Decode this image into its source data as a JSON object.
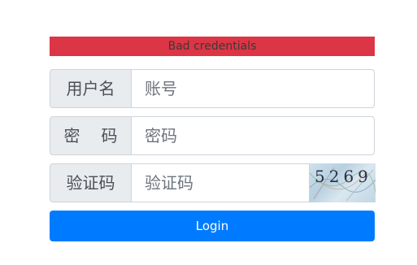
{
  "alert": {
    "message": "Bad credentials",
    "color": "#dc3545"
  },
  "form": {
    "username": {
      "label": "用户名",
      "placeholder": "账号",
      "value": ""
    },
    "password": {
      "label_chars": [
        "密",
        "码"
      ],
      "placeholder": "密码",
      "value": ""
    },
    "captcha": {
      "label": "验证码",
      "placeholder": "验证码",
      "value": "",
      "image_text": "5269"
    },
    "login_label": "Login",
    "accent_color": "#007bff"
  }
}
